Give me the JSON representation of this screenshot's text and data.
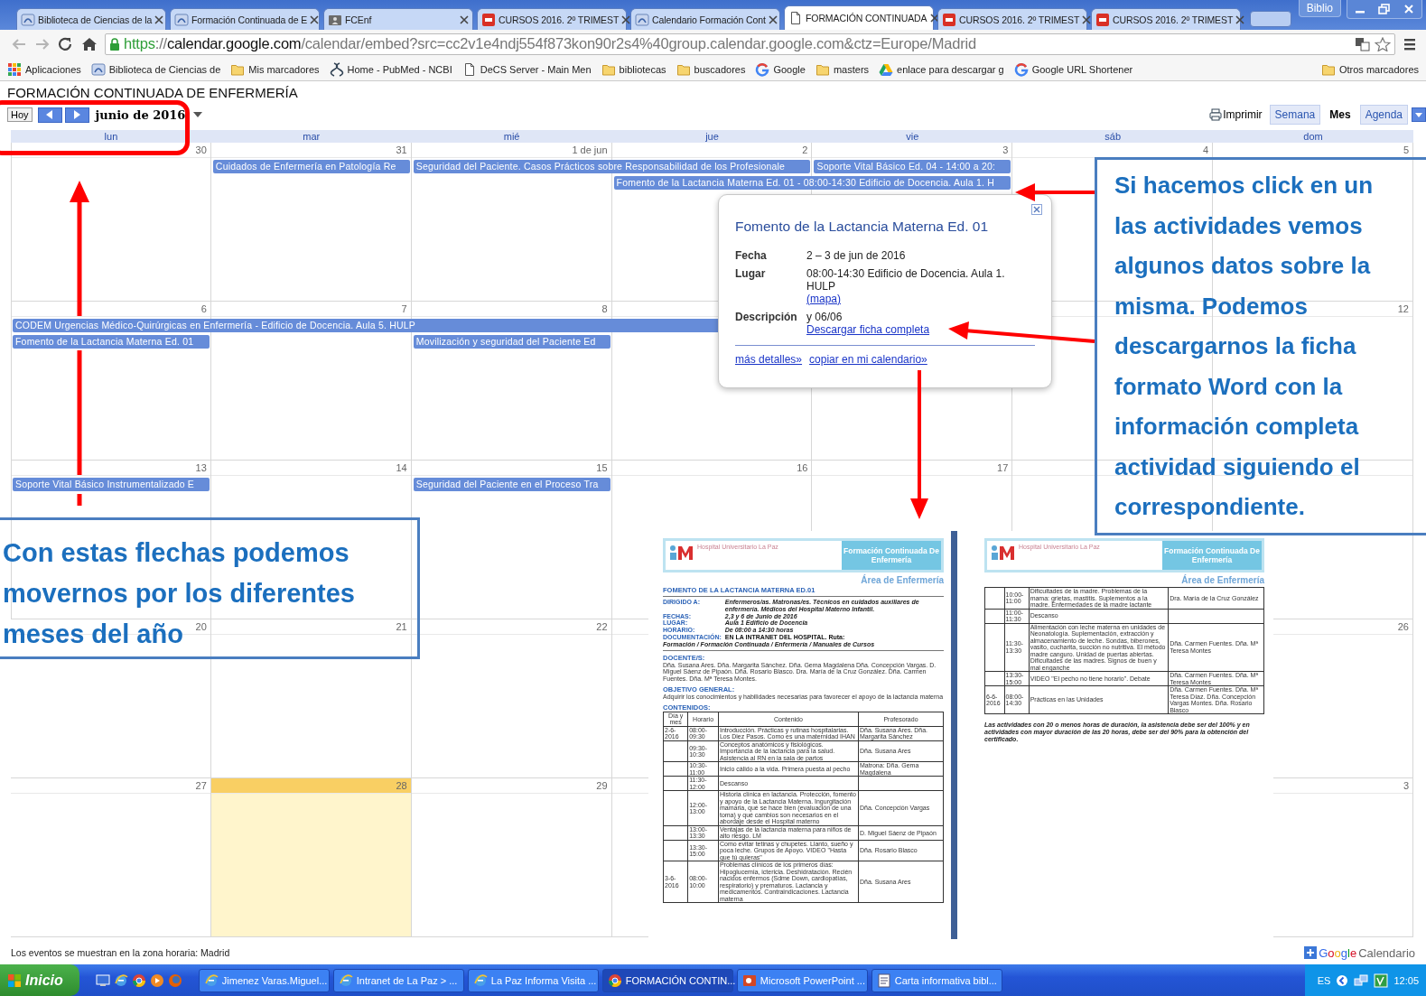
{
  "browser": {
    "tabs": [
      {
        "title": "Biblioteca de Ciencias de la",
        "kind": "site",
        "selected": false
      },
      {
        "title": "Formación Continuada de E",
        "kind": "site",
        "selected": false
      },
      {
        "title": "FCEnf",
        "kind": "folder_person",
        "selected": false
      },
      {
        "title": "CURSOS 2016. 2º TRIMEST",
        "kind": "pdf",
        "selected": false
      },
      {
        "title": "Calendario Formación Cont",
        "kind": "site",
        "selected": false
      },
      {
        "title": "FORMACIÓN CONTINUADA",
        "kind": "page",
        "selected": true
      },
      {
        "title": "CURSOS 2016. 2º TRIMEST",
        "kind": "pdf",
        "selected": false
      },
      {
        "title": "CURSOS 2016. 2º TRIMEST",
        "kind": "pdf",
        "selected": false
      }
    ],
    "profile_button": "Biblio",
    "url": [
      {
        "text": "https",
        "kind": "scheme"
      },
      {
        "text": "://",
        "kind": "dim"
      },
      {
        "text": "calendar.google.com",
        "kind": "host"
      },
      {
        "text": "/calendar/embed?src=cc2v1e4ndj554f873kon90r2s4%40group.calendar.google.com&ctz=Europe/Madrid",
        "kind": "dim"
      }
    ],
    "bookmarks": [
      {
        "label": "Aplicaciones",
        "kind": "apps"
      },
      {
        "label": "Biblioteca de Ciencias de",
        "kind": "site"
      },
      {
        "label": "Mis marcadores",
        "kind": "folder"
      },
      {
        "label": "Home - PubMed - NCBI",
        "kind": "pubmed"
      },
      {
        "label": "DeCS Server - Main Men",
        "kind": "page"
      },
      {
        "label": "bibliotecas",
        "kind": "folder"
      },
      {
        "label": "buscadores",
        "kind": "folder"
      },
      {
        "label": "Google",
        "kind": "google"
      },
      {
        "label": "masters",
        "kind": "folder"
      },
      {
        "label": "enlace para descargar g",
        "kind": "drive"
      },
      {
        "label": "Google URL Shortener",
        "kind": "google"
      }
    ],
    "other_bookmarks": {
      "label": "Otros marcadores",
      "kind": "folder"
    }
  },
  "calendar": {
    "title": "FORMACIÓN CONTINUADA DE ENFERMERÍA",
    "today_button": "Hoy",
    "period": "junio de 2016",
    "print": "Imprimir",
    "views": [
      {
        "label": "Semana",
        "selected": false
      },
      {
        "label": "Mes",
        "selected": true
      },
      {
        "label": "Agenda",
        "selected": false
      }
    ],
    "weekdays": [
      "lun",
      "mar",
      "mié",
      "jue",
      "vie",
      "sáb",
      "dom"
    ],
    "weeks": [
      {
        "days": [
          {
            "number": "30",
            "today": false
          },
          {
            "number": "31",
            "today": false,
            "upper_event": {
              "title": "Cuidados de Enfermería en Patología Re",
              "kind": "single"
            }
          },
          {
            "number": "1 de jun",
            "today": false,
            "upper_event": {
              "title": "Seguridad del Paciente. Casos Prácticos sobre Responsabilidad de los Profesionale",
              "kind": "double"
            }
          },
          {
            "number": "2",
            "today": false,
            "lower_event": {
              "title": "Fomento de la Lactancia Materna Ed. 01 - 08:00-14:30 Edificio de Docencia. Aula 1. H",
              "kind": "double"
            }
          },
          {
            "number": "3",
            "today": false,
            "upper_event": {
              "title": "Soporte Vital Básico Ed. 04 - 14:00 a 20:",
              "kind": "single"
            }
          },
          {
            "number": "4",
            "today": false
          },
          {
            "number": "5",
            "today": false
          }
        ]
      },
      {
        "days": [
          {
            "number": "6",
            "today": false,
            "upper_event": {
              "title": "CODEM Urgencias Médico-Quirúrgicas en Enfermería - Edificio de Docencia. Aula 5. HULP",
              "kind": "quadruple"
            },
            "lower_event": {
              "title": "Fomento de la Lactancia Materna Ed. 01",
              "kind": "single"
            }
          },
          {
            "number": "7",
            "today": false
          },
          {
            "number": "8",
            "today": false,
            "lower_event": {
              "title": "Movilización y seguridad del Paciente Ed",
              "kind": "single"
            }
          },
          {
            "today": false
          },
          {
            "today": false
          },
          {
            "today": false
          },
          {
            "number": "12",
            "today": false
          }
        ]
      },
      {
        "days": [
          {
            "number": "13",
            "today": false,
            "upper_event": {
              "title": "Soporte Vital Básico Instrumentalizado E",
              "kind": "single"
            }
          },
          {
            "number": "14",
            "today": false
          },
          {
            "number": "15",
            "today": false,
            "upper_event": {
              "title": "Seguridad del Paciente en el Proceso Tra",
              "kind": "single"
            }
          },
          {
            "number": "16",
            "today": false
          },
          {
            "number": "17",
            "today": false
          },
          {
            "today": false
          },
          {
            "today": false
          }
        ]
      },
      {
        "days": [
          {
            "number": "20",
            "today": false
          },
          {
            "number": "21",
            "today": false
          },
          {
            "number": "22",
            "today": false
          },
          {
            "today": false
          }
        ],
        "last_day": {
          "number": "26",
          "today": false
        }
      },
      {
        "days": [
          {
            "number": "27",
            "today": false
          },
          {
            "number": "28",
            "today": true
          },
          {
            "number": "29",
            "today": false
          },
          {
            "today": false
          }
        ],
        "last_day": {
          "number": "3",
          "today": false
        }
      }
    ],
    "timezone_note": "Los eventos se muestran en la zona horaria: Madrid",
    "badge": {
      "brand": "Google",
      "product": "Calendario"
    }
  },
  "event_popup": {
    "title": "Fomento de la Lactancia Materna Ed. 01",
    "rows": [
      {
        "label": "Fecha",
        "value": "2 – 3 de jun de 2016"
      },
      {
        "label": "Lugar",
        "value": "08:00-14:30 Edificio de Docencia. Aula 1. HULP",
        "link": "(mapa)"
      },
      {
        "label": "Descripción",
        "value": "y 06/06",
        "link": "Descargar ficha completa"
      }
    ],
    "links": [
      "más detalles»",
      "copiar en mi calendario»"
    ]
  },
  "annotations": {
    "left_callout": [
      "Con estas flechas podemos",
      "movernos por los diferentes",
      "meses del año"
    ],
    "right_callout": [
      "Si hacemos click en un",
      "las actividades vemos",
      "algunos datos sobre la",
      "misma. Podemos",
      "descargarnos la ficha",
      "formato Word con la",
      "información completa",
      "actividad siguiendo el",
      "correspondiente."
    ]
  },
  "documents": [
    {
      "kind": "first_page",
      "header": {
        "hospital": "Hospital Universitario La Paz",
        "program": "Formación Continuada De Enfermería"
      },
      "area": "Área de Enfermería",
      "title": "FOMENTO DE LA LACTANCIA MATERNA ED.01",
      "fields": [
        {
          "label": "DIRIGIDO A:",
          "value": "Enfermeros/as. Matronas/es. Técnicos en cuidados auxiliares de enfermería. Médicos del Hospital Materno Infantil."
        },
        {
          "label": "FECHAS:",
          "value": "2,3 y 6 de Junio de 2016"
        },
        {
          "label": "LUGAR:",
          "value": "Aula 1 Edificio de Docencia"
        },
        {
          "label": "HORARIO:",
          "value": "De 08:00 a 14:30 horas"
        }
      ],
      "documentation": {
        "label": "DOCUMENTACIÓN:",
        "value": "EN LA INTRANET DEL HOSPITAL. Ruta:"
      },
      "route": "Formación / Formación Continuada / Enfermería / Manuales de Cursos",
      "sections": [
        {
          "heading": "DOCENTE/S:",
          "text": "Dña. Susana Ares. Dña. Margarita Sánchez. Dña. Gema Magdalena Dña. Concepción Vargas. D. Miguel Sáenz de Pipaón. Dña. Rosario Blasco. Dra. María de la Cruz González. Dña. Carmen Fuentes. Dña. Mª Teresa Montes."
        },
        {
          "heading": "OBJETIVO GENERAL:",
          "text": "Adquirir los conocimientos y habilidades necesarias para favorecer el apoyo de la lactancia materna"
        },
        {
          "heading": "CONTENIDOS:"
        }
      ],
      "table": {
        "columns": [
          "Día y mes",
          "Horario",
          "Contenido",
          "Profesorado"
        ],
        "rows": [
          {
            "date": "2-6-2016",
            "time": "08:00-09:30",
            "content": "Introducción. Prácticas y rutinas hospitalarias. Los Diez Pasos. Como es una maternidad IHAN",
            "teacher": "Dña. Susana Ares. Dña. Margarita Sánchez"
          },
          {
            "time": "09:30-10:30",
            "content": "Conceptos anatómicos y fisiológicos. Importancia de la lactancia para la salud. Asistencia al RN en la sala de partos",
            "teacher": "Dña. Susana Ares"
          },
          {
            "time": "10:30-11:00",
            "content": "Inicio cálido a la vida. Primera puesta al pecho",
            "teacher": "Matrona: Dña. Gema Magdalena"
          },
          {
            "time": "11:30-12:00",
            "content": "Descanso"
          },
          {
            "time": "12:00-13:00",
            "content": "Historia clínica en lactancia. Protección, fomento y apoyo de la Lactancia Materna. Ingurgitación mamaria, qué se hace bien (evaluación de una toma) y qué cambios son necesarios en el abordaje desde el Hospital materno",
            "teacher": "Dña. Concepción Vargas"
          },
          {
            "time": "13:00-13:30",
            "content": "Ventajas de la lactancia materna para niños de alto riesgo. LM",
            "teacher": "D. Miguel Sáenz de Pipaón"
          },
          {
            "time": "13:30-15:00",
            "content": "Como evitar tetinas y chupetes. Llanto, sueño y poca leche. Grupos de Apoyo. VIDEO \"Hasta que tú quieras\"",
            "teacher": "Dña. Rosario Blasco"
          },
          {
            "date": "3-6-2016",
            "time": "08:00-10:00",
            "content": "Problemas clínicos de los primeros días: Hipoglucemia, ictericia. Deshidratación. Recién nacidos enfermos (Sdme Down, cardiopatías, respiratorio) y prematuros. Lactancia y medicamentos. Contraindicaciones. Lactancia materna",
            "teacher": "Dña. Susana Ares"
          }
        ]
      }
    },
    {
      "kind": "continuation",
      "header": {
        "hospital": "Hospital Universitario La Paz",
        "program": "Formación Continuada De Enfermería"
      },
      "area": "Área de Enfermería",
      "table": {
        "rows": [
          {
            "time": "10:00-11:00",
            "content": "Dificultades de la madre. Problemas de la mama: grietas, mastitis. Suplementos a la madre. Enfermedades de la madre lactante",
            "teacher": "Dra. María de la Cruz González"
          },
          {
            "time": "11:00-11:30",
            "content": "Descanso"
          },
          {
            "time": "11:30-13:30",
            "content": "Alimentación con leche materna en unidades de Neonatología. Suplementación, extracción y almacenamiento de leche. Sondas, biberones, vasito, cucharita, succión no nutritiva. El método madre canguro. Unidad de puertas abiertas. Dificultades de las madres. Signos de buen y mal enganche",
            "teacher": "Dña. Carmen Fuentes. Dña. Mª Teresa Montes"
          },
          {
            "time": "13:30-15:00",
            "content": "VIDEO \"El pecho no tiene horario\". Debate",
            "teacher": "Dña. Carmen Fuentes. Dña. Mª Teresa Montes"
          },
          {
            "date": "6-6-2016",
            "time": "08:00-14:30",
            "content": "Prácticas en las Unidades",
            "teacher": "Dña. Carmen Fuentes. Dña. Mª Teresa Díaz. Dña. Concepción Vargas Montes. Dña. Rosario Blasco"
          }
        ]
      },
      "note": "Las actividades con 20 o menos horas de duración, la asistencia debe ser del 100% y en actividades con mayor duración de las 20 horas, debe ser del 90% para la obtención del certificado."
    }
  ],
  "taskbar": {
    "start": "Inicio",
    "quick_launch": [
      {
        "kind": "desktop"
      },
      {
        "kind": "ie"
      },
      {
        "kind": "chrome"
      },
      {
        "kind": "media"
      },
      {
        "kind": "firefox"
      }
    ],
    "tasks": [
      {
        "label": "Jimenez Varas.Miguel...",
        "kind": "ie",
        "selected": false
      },
      {
        "label": "Intranet de La Paz > ...",
        "kind": "ie",
        "selected": false
      },
      {
        "label": "La Paz Informa Visita ...",
        "kind": "ie",
        "selected": false
      },
      {
        "label": "FORMACIÓN CONTIN...",
        "kind": "chrome",
        "selected": true
      },
      {
        "label": "Microsoft PowerPoint ...",
        "kind": "powerpoint",
        "selected": false
      },
      {
        "label": "Carta informativa bibl...",
        "kind": "document",
        "selected": false
      }
    ],
    "language": "ES",
    "clock": "12:05"
  }
}
